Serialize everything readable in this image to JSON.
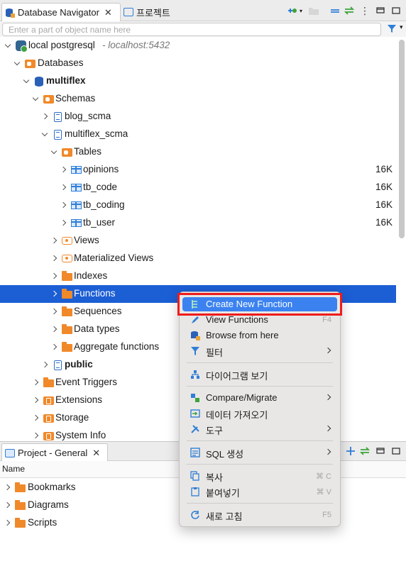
{
  "top_tabs": {
    "navigator_label": "Database Navigator",
    "project_label": "프로젝트"
  },
  "filter": {
    "placeholder": "Enter a part of object name here"
  },
  "tree": {
    "connection": {
      "name": "local postgresql",
      "host": "- localhost:5432"
    },
    "databases": "Databases",
    "db_name": "multiflex",
    "schemas": "Schemas",
    "blog_scma": "blog_scma",
    "multiflex_scma": "multiflex_scma",
    "tables": "Tables",
    "table_rows": [
      {
        "name": "opinions",
        "size": "16K"
      },
      {
        "name": "tb_code",
        "size": "16K"
      },
      {
        "name": "tb_coding",
        "size": "16K"
      },
      {
        "name": "tb_user",
        "size": "16K"
      }
    ],
    "views": "Views",
    "mat_views": "Materialized Views",
    "indexes": "Indexes",
    "functions": "Functions",
    "sequences": "Sequences",
    "data_types": "Data types",
    "aggregate": "Aggregate functions",
    "public": "public",
    "event_triggers": "Event Triggers",
    "extensions": "Extensions",
    "storage": "Storage",
    "system_info": "System Info"
  },
  "bottom": {
    "tab_label": "Project - General",
    "name_header": "Name",
    "items": [
      "Bookmarks",
      "Diagrams",
      "Scripts"
    ]
  },
  "context_menu": {
    "create_new_function": "Create New Function",
    "view_functions": "View Functions",
    "view_functions_shortcut": "F4",
    "browse_from_here": "Browse from here",
    "filter": "필터",
    "diagram": "다이어그램 보기",
    "compare": "Compare/Migrate",
    "import_data": "데이터 가져오기",
    "tools": "도구",
    "sql_gen": "SQL 생성",
    "copy": "복사",
    "copy_shortcut": "⌘ C",
    "paste": "붙여넣기",
    "paste_shortcut": "⌘ V",
    "refresh": "새로 고침",
    "refresh_shortcut": "F5"
  },
  "colors": {
    "selection": "#1c5ed4",
    "menu_highlight": "#3b82f0",
    "annotation_box": "#ee1c1c",
    "folder_icon": "#f0892a",
    "table_icon": "#2f7ed8"
  }
}
